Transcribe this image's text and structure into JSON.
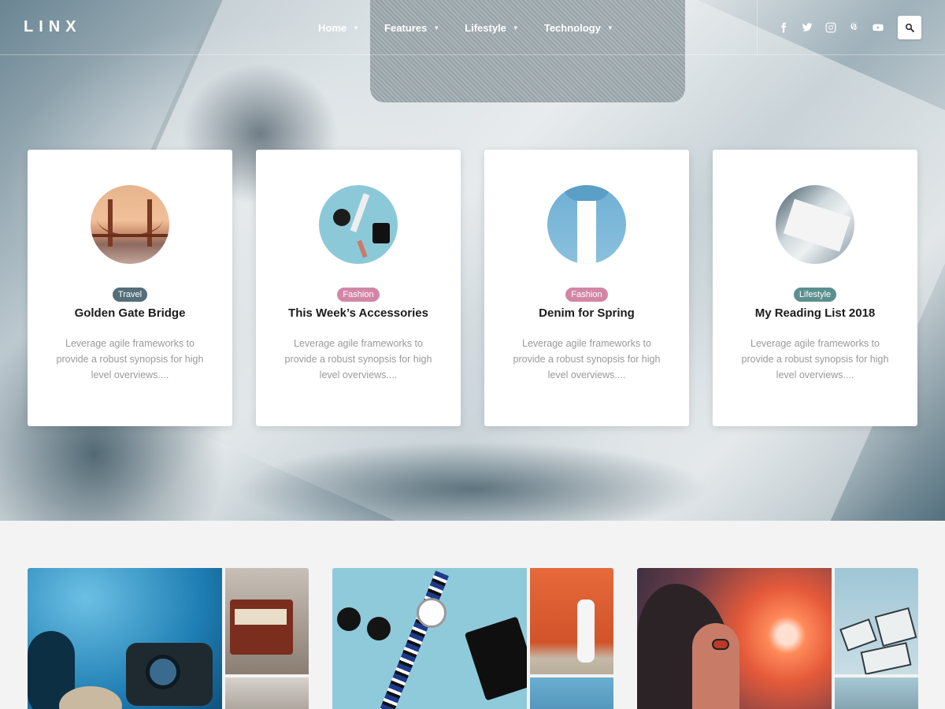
{
  "brand": {
    "logo": "LINX"
  },
  "nav": [
    {
      "label": "Home"
    },
    {
      "label": "Features"
    },
    {
      "label": "Lifestyle"
    },
    {
      "label": "Technology"
    }
  ],
  "social": [
    "facebook-icon",
    "twitter-icon",
    "instagram-icon",
    "pinterest-icon",
    "youtube-icon"
  ],
  "search_icon": "search-icon",
  "cards": [
    {
      "category": "Travel",
      "category_color": "#546e7a",
      "title": "Golden Gate Bridge",
      "excerpt": "Leverage agile frameworks to provide a robust synopsis for high level overviews...."
    },
    {
      "category": "Fashion",
      "category_color": "#d286a6",
      "title": "This Week’s Accessories",
      "excerpt": "Leverage agile frameworks to provide a robust synopsis for high level overviews...."
    },
    {
      "category": "Fashion",
      "category_color": "#d286a6",
      "title": "Denim for Spring",
      "excerpt": "Leverage agile frameworks to provide a robust synopsis for high level overviews...."
    },
    {
      "category": "Lifestyle",
      "category_color": "#5c8f8f",
      "title": "My Reading List 2018",
      "excerpt": "Leverage agile frameworks to provide a robust synopsis for high level overviews...."
    }
  ]
}
